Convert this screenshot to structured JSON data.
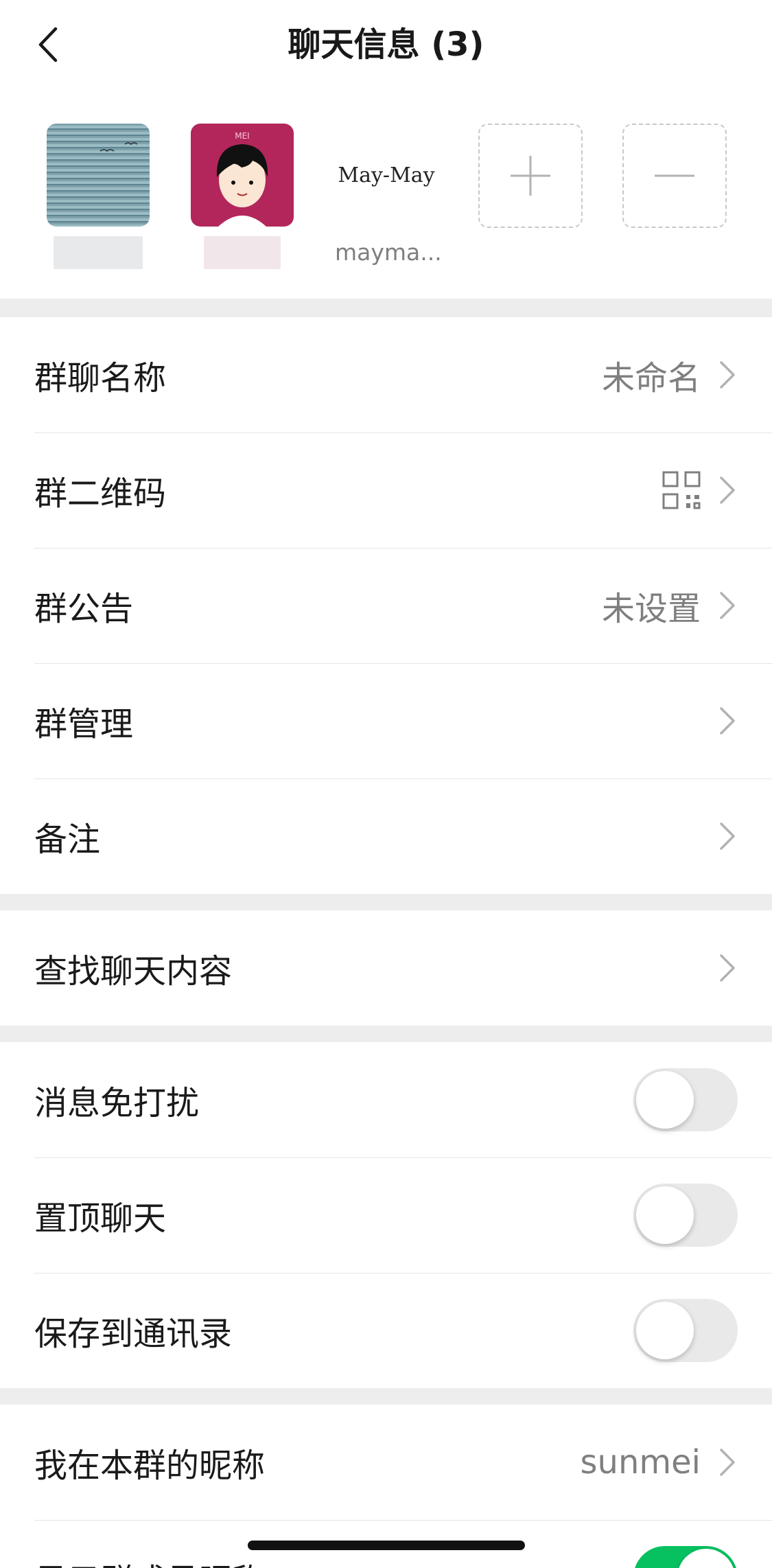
{
  "header": {
    "title": "聊天信息 (3)"
  },
  "members": [
    {
      "name": ""
    },
    {
      "name": ""
    },
    {
      "name": "mayma...",
      "avatar_text": "May-May"
    }
  ],
  "section1": [
    {
      "label": "群聊名称",
      "value": "未命名"
    },
    {
      "label": "群二维码"
    },
    {
      "label": "群公告",
      "value": "未设置"
    },
    {
      "label": "群管理"
    },
    {
      "label": "备注"
    }
  ],
  "section2": [
    {
      "label": "查找聊天内容"
    }
  ],
  "section3": [
    {
      "label": "消息免打扰",
      "on": false
    },
    {
      "label": "置顶聊天",
      "on": false
    },
    {
      "label": "保存到通讯录",
      "on": false
    }
  ],
  "section4": [
    {
      "label": "我在本群的昵称",
      "value": "sunmei"
    },
    {
      "label": "显示群成员昵称",
      "on": true
    }
  ],
  "colors": {
    "accent": "#07c160",
    "background": "#ededed"
  }
}
